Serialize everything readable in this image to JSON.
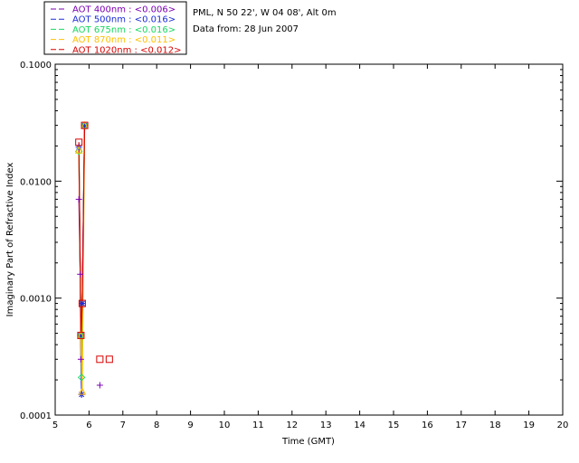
{
  "header": {
    "station": "PML, N 50 22', W 04 08', Alt 0m",
    "date_line": "Data from: 28 Jun 2007"
  },
  "chart_data": {
    "type": "line",
    "title": "",
    "xlabel": "Time (GMT)",
    "ylabel": "Imaginary Part of Refractive Index",
    "xlim": [
      5,
      20
    ],
    "ylim": [
      0.0001,
      0.1
    ],
    "yscale": "log",
    "grid": false,
    "legend_position": "top-left-outside",
    "x_ticks": [
      "5",
      "6",
      "7",
      "8",
      "9",
      "10",
      "11",
      "12",
      "13",
      "14",
      "15",
      "16",
      "17",
      "18",
      "19",
      "20"
    ],
    "y_ticks": [
      {
        "value": 0.0001,
        "label": "0.0001"
      },
      {
        "value": 0.001,
        "label": "0.0010"
      },
      {
        "value": 0.01,
        "label": "0.0100"
      },
      {
        "value": 0.1,
        "label": "0.1000"
      }
    ],
    "series": [
      {
        "name": "AOT  400nm : <0.006>",
        "color": "#7a00b0",
        "marker": "plus",
        "x": [
          5.7,
          5.74,
          5.76,
          5.78,
          5.8,
          5.87,
          6.32
        ],
        "y": [
          0.007,
          0.0016,
          0.0003,
          0.00015,
          0.0009,
          0.03,
          0.00018
        ]
      },
      {
        "name": "AOT  500nm : <0.016>",
        "color": "#1a2bd6",
        "marker": "asterisk",
        "x": [
          5.7,
          5.76,
          5.78,
          5.8,
          5.87
        ],
        "y": [
          0.0195,
          0.00048,
          0.00015,
          0.0009,
          0.03
        ]
      },
      {
        "name": "AOT  675nm : <0.016>",
        "color": "#18d860",
        "marker": "diamond",
        "x": [
          5.7,
          5.76,
          5.78,
          5.87
        ],
        "y": [
          0.018,
          0.00048,
          0.00021,
          0.03
        ]
      },
      {
        "name": "AOT  870nm : <0.011>",
        "color": "#ffc000",
        "marker": "triangle",
        "x": [
          5.7,
          5.76,
          5.8,
          5.87
        ],
        "y": [
          0.0185,
          0.00048,
          0.00016,
          0.03
        ]
      },
      {
        "name": "AOT 1020nm : <0.012>",
        "color": "#d80000",
        "marker": "square",
        "x": [
          5.7,
          5.76,
          5.8,
          5.87,
          6.32,
          6.6
        ],
        "y": [
          0.0215,
          0.00048,
          0.0009,
          0.03,
          0.0003,
          0.0003
        ]
      }
    ]
  }
}
